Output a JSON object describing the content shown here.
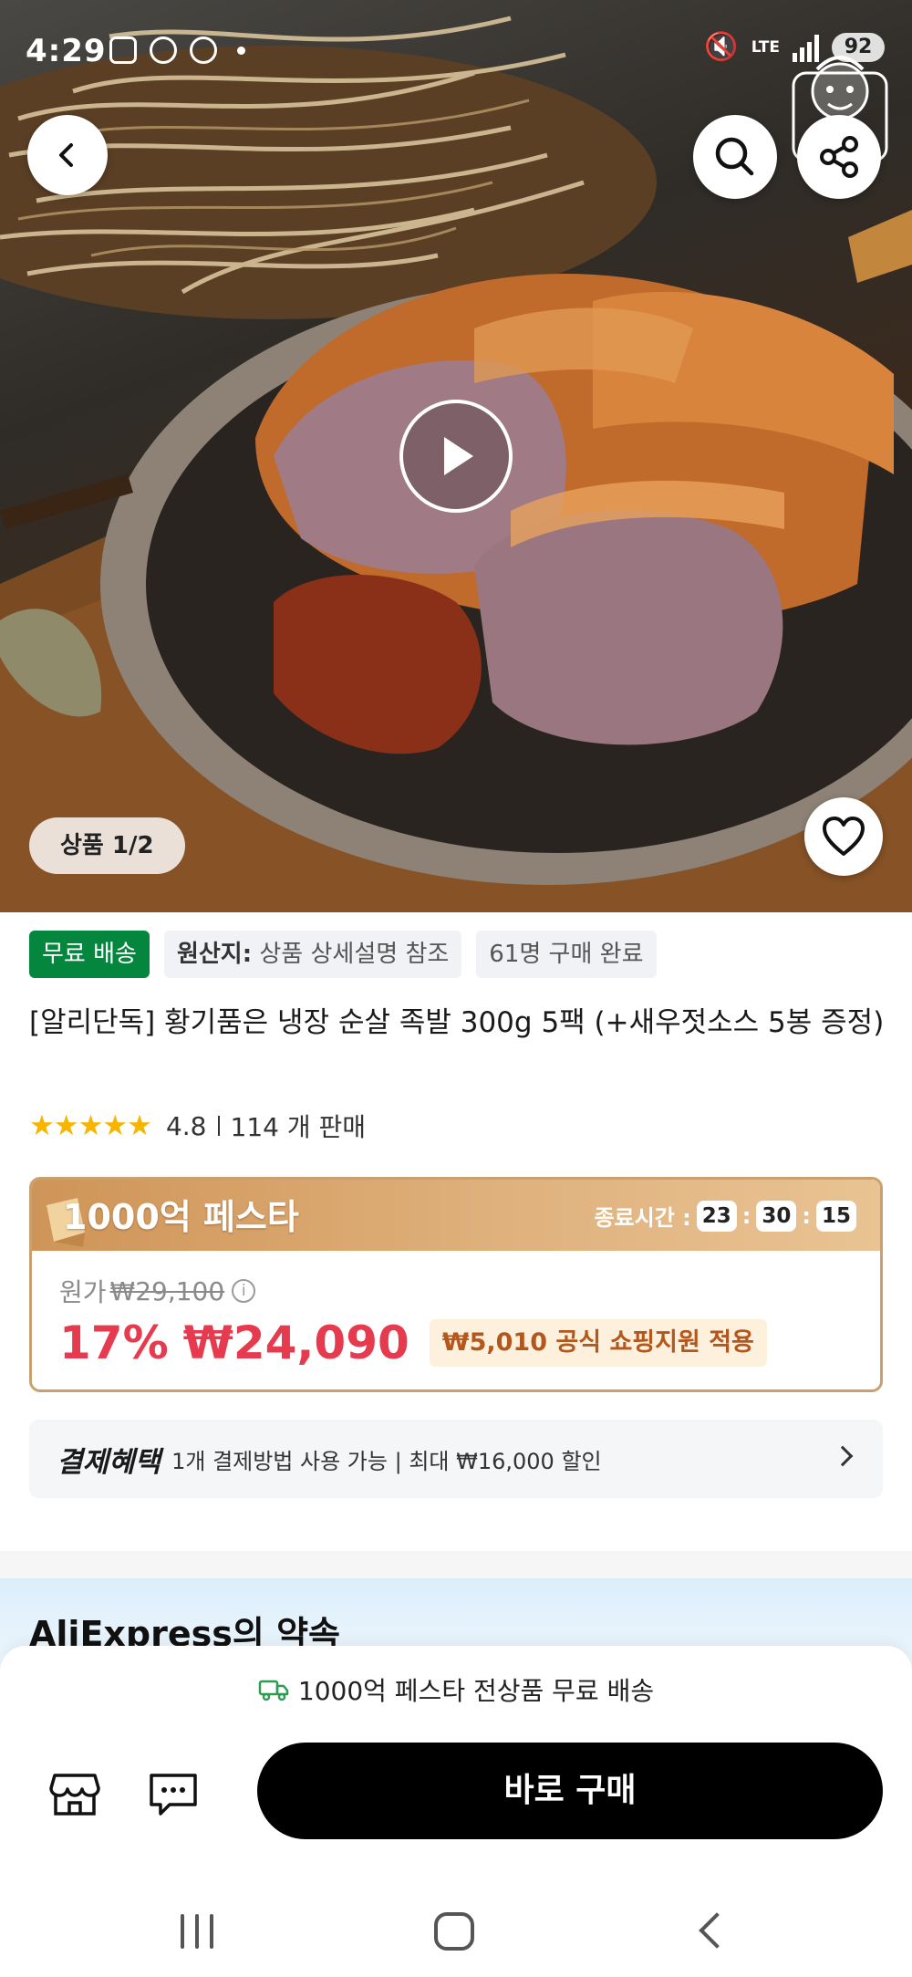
{
  "status_bar": {
    "time": "4:29",
    "network": "LTE",
    "battery": "92"
  },
  "hero": {
    "image_counter": "상품 1/2"
  },
  "product": {
    "tags": {
      "free_shipping": "무료 배송",
      "origin_label": "원산지:",
      "origin_value": " 상품 상세설명 참조",
      "purchases": "61명 구매 완료"
    },
    "title": "[알리단독] 황기품은 냉장 순살 족발 300g 5팩 (+새우젓소스 5봉 증정)",
    "stars": "★★★★★",
    "rating": "4.8",
    "sold": "114 개 판매"
  },
  "festa": {
    "title": "1000억 페스타",
    "timer_label": "종료시간 :",
    "timer": {
      "hours": "23",
      "minutes": "30",
      "seconds": "15"
    },
    "timer_sep": ":",
    "original_label": "원가",
    "original_price": "₩29,100",
    "discount_pct": "17%",
    "price": "₩24,090",
    "subsidy": "₩5,010 공식 쇼핑지원 적용"
  },
  "payment": {
    "label": "결제혜택",
    "text": "1개 결제방법 사용 가능 | 최대 ₩16,000 할인"
  },
  "promise": {
    "title": "AliExpress의 약속"
  },
  "bottom_bar": {
    "free_shipping_note": "1000억 페스타 전상품 무료 배송",
    "buy_now": "바로 구매"
  },
  "colors": {
    "free_tag": "#05863f",
    "price_red": "#e63a4e",
    "festa_gold": "#cf9457",
    "buy_button": "#000000"
  },
  "icons": [
    "back-icon",
    "search-icon",
    "share-icon",
    "play-icon",
    "heart-icon",
    "info-icon",
    "chevron-right-icon",
    "truck-icon",
    "store-icon",
    "chat-icon"
  ]
}
